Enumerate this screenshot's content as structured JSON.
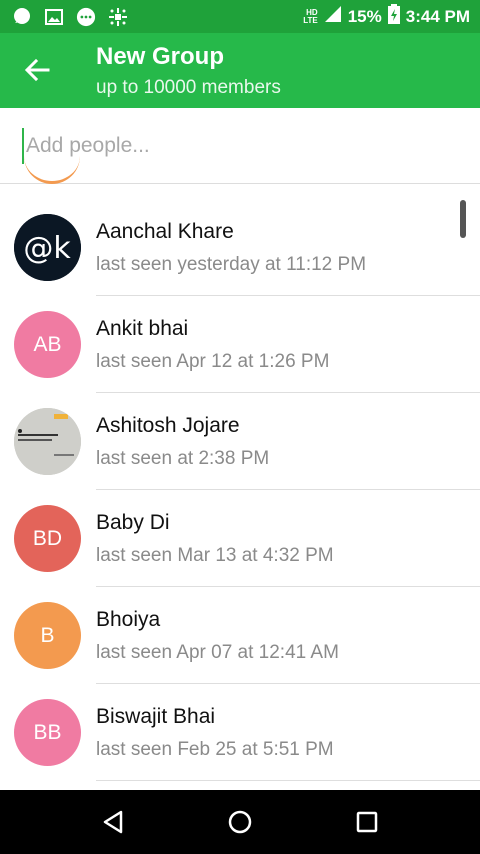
{
  "status_bar": {
    "network_top": "HD",
    "network_label": "LTE",
    "battery": "15%",
    "time": "3:44 PM",
    "icons": [
      "chat-bubble-icon",
      "image-icon",
      "message-icon",
      "sparkle-icon"
    ]
  },
  "app_bar": {
    "title": "New Group",
    "subtitle": "up to 10000 members"
  },
  "search": {
    "placeholder": "Add people..."
  },
  "contacts": [
    {
      "name": "Aanchal Khare",
      "status": "last seen yesterday at 11:12 PM",
      "initials": "@k",
      "avatar_type": "image",
      "color": "#0b1724"
    },
    {
      "name": "Ankit bhai",
      "status": "last seen Apr 12 at 1:26 PM",
      "initials": "AB",
      "avatar_type": "initials",
      "color": "#f07ba2"
    },
    {
      "name": "Ashitosh Jojare",
      "status": "last seen at 2:38 PM",
      "initials": "",
      "avatar_type": "image",
      "color": "#c9c9c4"
    },
    {
      "name": "Baby Di",
      "status": "last seen Mar 13 at 4:32 PM",
      "initials": "BD",
      "avatar_type": "initials",
      "color": "#e3645a"
    },
    {
      "name": "Bhoiya",
      "status": "last seen Apr 07 at 12:41 AM",
      "initials": "B",
      "avatar_type": "initials",
      "color": "#f39a4f"
    },
    {
      "name": "Biswajit Bhai",
      "status": "last seen Feb 25 at 5:51 PM",
      "initials": "BB",
      "avatar_type": "initials",
      "color": "#f07ba2"
    }
  ],
  "colors": {
    "status_bar": "#1fa23a",
    "app_bar": "#26b94a",
    "accent": "#2fb54a"
  }
}
